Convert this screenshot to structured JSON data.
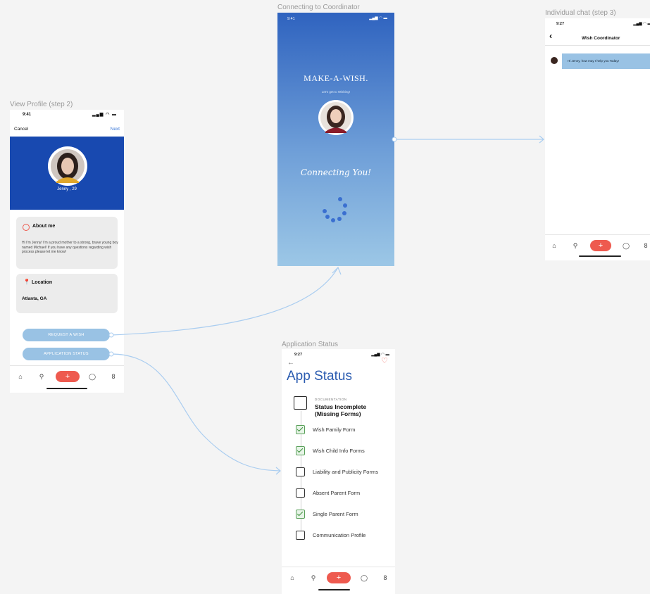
{
  "frames": {
    "profile_label": "View Profile (step 2)",
    "connecting_label": "Connecting to Coordinator",
    "chat_label": "Individual chat (step 3)",
    "status_label": "Application Status"
  },
  "profile": {
    "time": "9:41",
    "cancel": "Cancel",
    "next": "Next",
    "name": "Jenny , 29",
    "about_title": "About me",
    "about_text": "Hi I'm Jenny! I'm a proud mother to a strong, brave young boy named Michael! If you have any questions regarding wish process please let me know!",
    "location_title": "Location",
    "location_value": "Atlanta, GA",
    "request_button": "REQUEST A WISH",
    "status_button": "APPLICATION STATUS"
  },
  "connecting": {
    "time": "9:41",
    "logo": "MAKE-A-WISH.",
    "tagline": "Let's get to Wishing!",
    "connecting_text": "Connecting You!"
  },
  "chat": {
    "time": "9:27",
    "title": "Wish Coordinator",
    "message": "Hi Jenny, how may I help you Today!"
  },
  "status": {
    "time": "9:27",
    "title": "App Status",
    "doc_label": "DOCUMENTATION",
    "doc_status": "Status Incomplete (Missing Forms)",
    "items": [
      {
        "label": "Wish Family Form",
        "checked": true
      },
      {
        "label": "Wish Child Info Forms",
        "checked": true
      },
      {
        "label": "Liability and Publicity Forms",
        "checked": false
      },
      {
        "label": "Absent Parent Form",
        "checked": false
      },
      {
        "label": "Single Parent Form",
        "checked": true
      },
      {
        "label": "Communication Profile",
        "checked": false
      }
    ]
  },
  "icons": {
    "home": "home-icon",
    "search": "search-icon",
    "add": "plus-icon",
    "chat": "chat-bubble-icon",
    "profile": "person-icon",
    "back": "back-arrow-icon",
    "heart": "heart-icon",
    "about": "smile-icon",
    "location": "location-pin-icon"
  },
  "colors": {
    "profile_header": "#1849b0",
    "accent_red": "#ee5a4f",
    "pill_blue": "#99c2e4",
    "gradient_top": "#2f63bf",
    "gradient_bottom": "#9cc7e6",
    "connector": "#aacdf0"
  }
}
